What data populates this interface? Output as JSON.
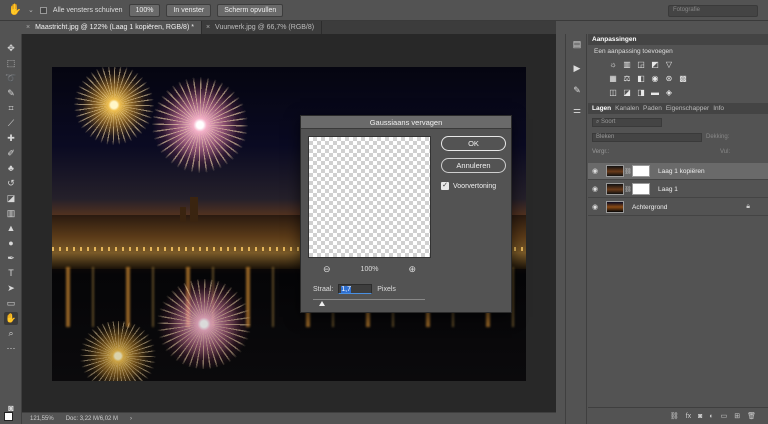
{
  "options_bar": {
    "all_windows_label": "Alle vensters schuiven",
    "zoom_button": "100%",
    "fit_button": "In venster",
    "fill_button": "Scherm opvullen",
    "workspace_placeholder": "Fotografie"
  },
  "tabs": [
    {
      "label": "Maastricht.jpg @ 122% (Laag 1 kopiëren, RGB/8) *"
    },
    {
      "label": "Vuurwerk.jpg @ 66,7% (RGB/8)"
    }
  ],
  "statusbar": {
    "zoom": "121,55%",
    "doc": "Doc: 3,22 M/6,02 M"
  },
  "dialog": {
    "title": "Gaussiaans vervagen",
    "ok": "OK",
    "cancel": "Annuleren",
    "preview_label": "Voorvertoning",
    "zoom_level": "100%",
    "radius_label": "Straal:",
    "radius_value": "1,7",
    "radius_unit": "Pixels"
  },
  "adjustments": {
    "tab": "Aanpassingen",
    "subtitle": "Een aanpassing toevoegen"
  },
  "layers_panel": {
    "tabs": [
      "Lagen",
      "Kanalen",
      "Paden",
      "Eigenschapper",
      "Info"
    ],
    "filter_placeholder": "Soort",
    "blend_mode": "Bleken",
    "opacity_label": "Dekking:",
    "lock_label": "Vergr.:",
    "fill_label": "Vul:",
    "layers": [
      {
        "name": "Laag 1 kopiëren"
      },
      {
        "name": "Laag 1"
      },
      {
        "name": "Achtergrond"
      }
    ]
  },
  "colors": {
    "accent": "#4a90e2"
  }
}
